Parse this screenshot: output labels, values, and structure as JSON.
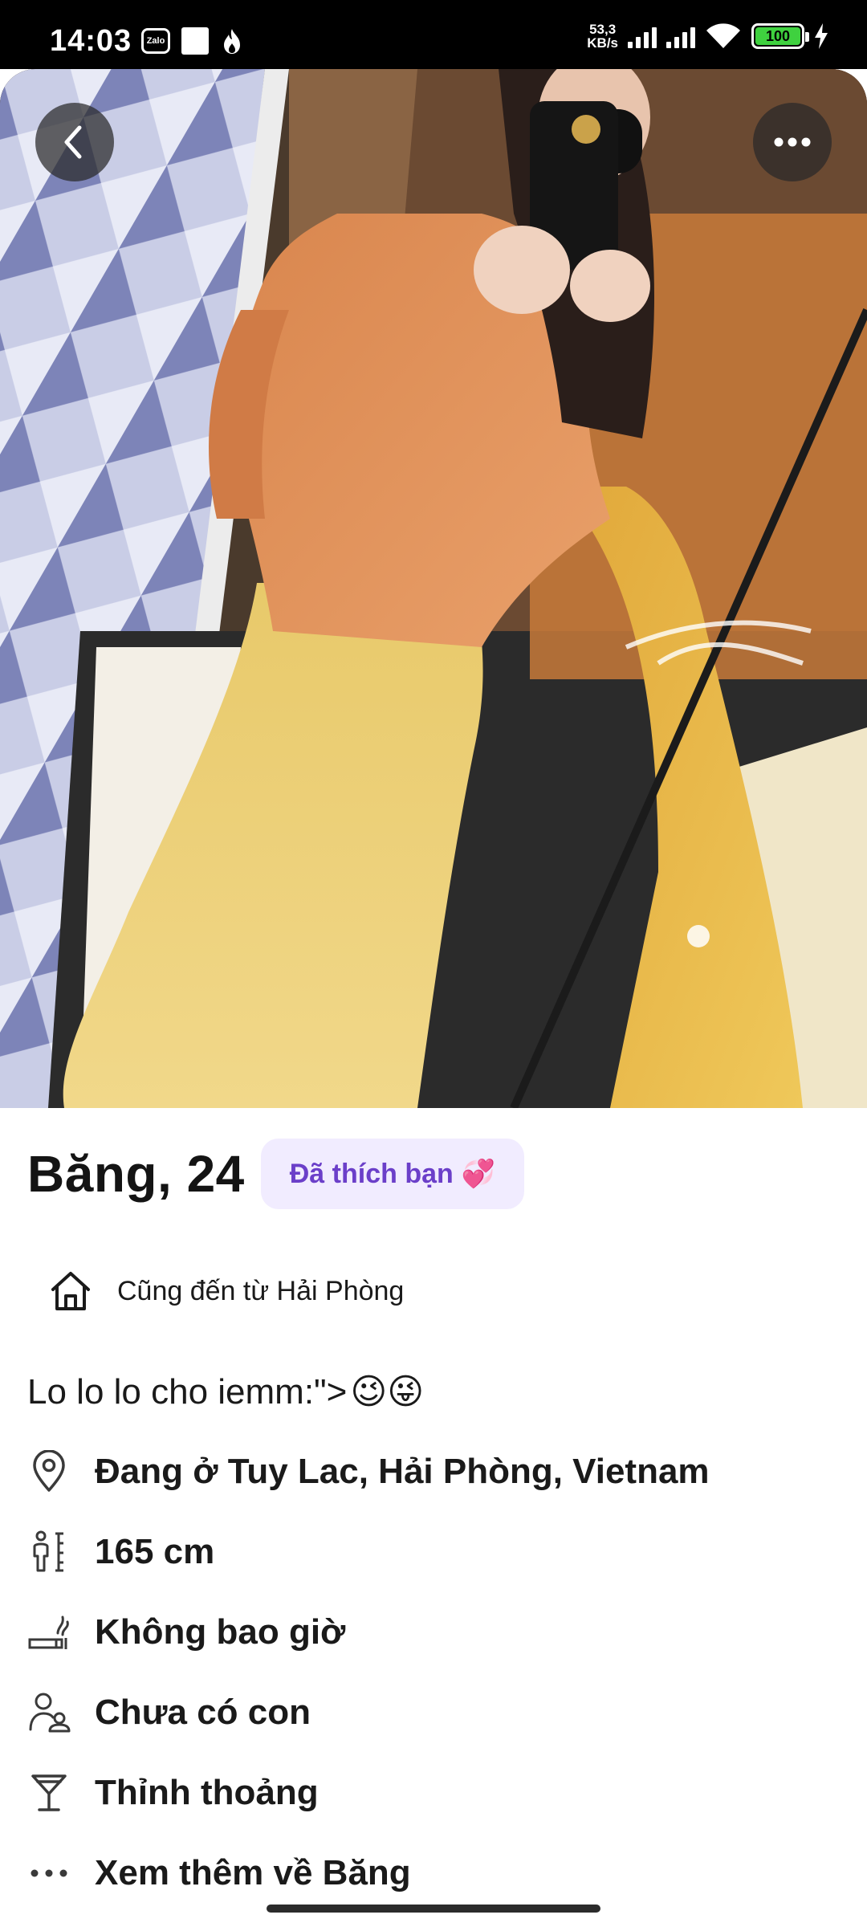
{
  "status_bar": {
    "time": "14:03",
    "zalo_label": "Zalo",
    "net_speed_value": "53,3",
    "net_speed_unit": "KB/s",
    "battery_level": "100",
    "icons": [
      "zalo-icon",
      "notification-square-icon",
      "fire-icon",
      "signal-icon",
      "wifi-icon",
      "battery-icon",
      "charging-icon"
    ]
  },
  "photo": {
    "back_icon": "chevron-left-icon",
    "more_icon": "more-horizontal-icon"
  },
  "profile": {
    "name_age": "Băng, 24",
    "liked_badge": "Đã thích bạn",
    "liked_emoji": "💞",
    "hometown": "Cũng đến từ Hải Phòng",
    "bio": "Lo lo lo cho iemm:\">",
    "bio_emojis": "😉😜",
    "details": [
      {
        "icon": "location-pin-icon",
        "text": "Đang ở Tuy Lac, Hải Phòng, Vietnam"
      },
      {
        "icon": "height-icon",
        "text": "165 cm"
      },
      {
        "icon": "smoking-icon",
        "text": "Không bao giờ"
      },
      {
        "icon": "children-icon",
        "text": "Chưa có con"
      },
      {
        "icon": "drink-icon",
        "text": "Thỉnh thoảng"
      },
      {
        "icon": "more-dots-icon",
        "text": "Xem thêm về Băng"
      }
    ]
  },
  "colors": {
    "accent_text": "#6b3fc9",
    "accent_bg": "#f1ecff",
    "battery": "#3fd13f"
  }
}
